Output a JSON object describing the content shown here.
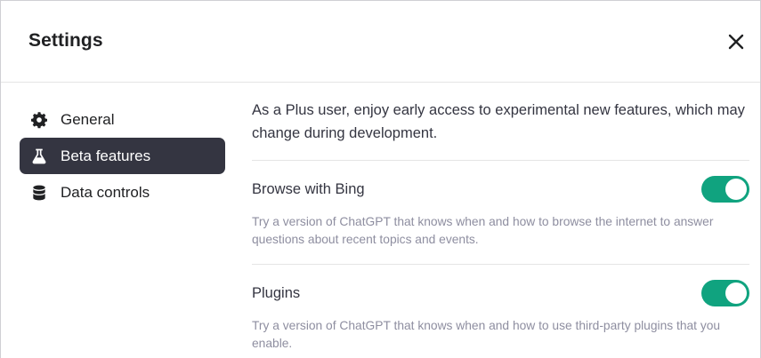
{
  "dialog": {
    "title": "Settings",
    "close_icon": "close-icon"
  },
  "sidebar": {
    "items": [
      {
        "label": "General",
        "icon": "gear-icon",
        "active": false
      },
      {
        "label": "Beta features",
        "icon": "flask-icon",
        "active": true
      },
      {
        "label": "Data controls",
        "icon": "database-icon",
        "active": false
      }
    ]
  },
  "main": {
    "intro": "As a Plus user, enjoy early access to experimental new features, which may change during development.",
    "features": [
      {
        "title": "Browse with Bing",
        "description": "Try a version of ChatGPT that knows when and how to browse the internet to answer questions about recent topics and events.",
        "enabled": true
      },
      {
        "title": "Plugins",
        "description": "Try a version of ChatGPT that knows when and how to use third-party plugins that you enable.",
        "enabled": true
      }
    ]
  },
  "colors": {
    "accent": "#10a37f",
    "active_nav_bg": "#343541"
  }
}
